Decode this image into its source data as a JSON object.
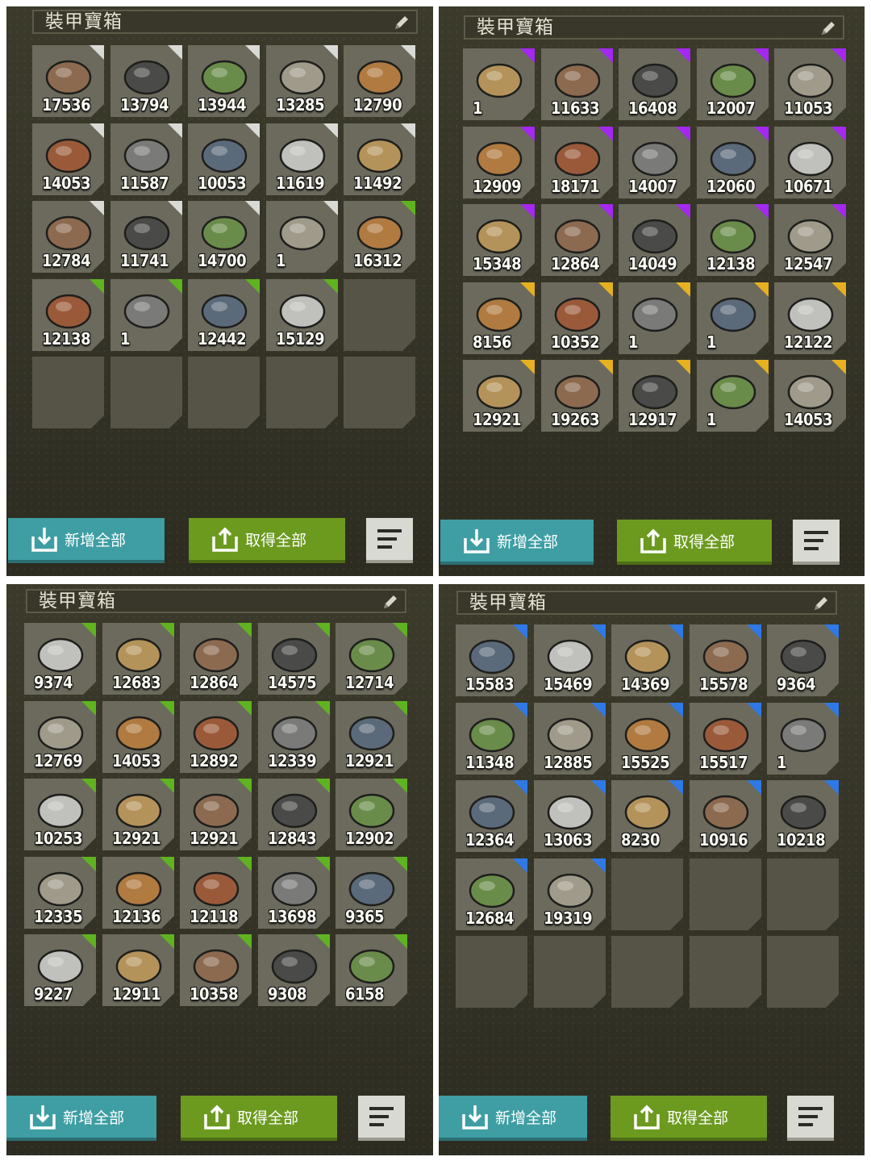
{
  "panels": [
    {
      "title": "裝甲寶箱",
      "add_all_label": "新增全部",
      "take_all_label": "取得全部",
      "items": [
        {
          "qty": "17536",
          "icon": "raw-meat-icon",
          "rarity": "white"
        },
        {
          "qty": "13794",
          "icon": "cloth-icon",
          "rarity": "white"
        },
        {
          "qty": "13944",
          "icon": "wire-coil-icon",
          "rarity": "white"
        },
        {
          "qty": "13285",
          "icon": "ore-icon",
          "rarity": "white"
        },
        {
          "qty": "12790",
          "icon": "plant-fiber-icon",
          "rarity": "white"
        },
        {
          "qty": "14053",
          "icon": "logs-icon",
          "rarity": "white"
        },
        {
          "qty": "11587",
          "icon": "planks-icon",
          "rarity": "white"
        },
        {
          "qty": "10053",
          "icon": "sand-pile-icon",
          "rarity": "white"
        },
        {
          "qty": "11619",
          "icon": "gas-canister-icon",
          "rarity": "white"
        },
        {
          "qty": "11492",
          "icon": "rope-icon",
          "rarity": "white"
        },
        {
          "qty": "12784",
          "icon": "leather-hide-icon",
          "rarity": "white"
        },
        {
          "qty": "11741",
          "icon": "stone-icon",
          "rarity": "white"
        },
        {
          "qty": "14700",
          "icon": "log-icon",
          "rarity": "white"
        },
        {
          "qty": "1",
          "icon": "tire-icon",
          "rarity": "white"
        },
        {
          "qty": "16312",
          "icon": "amber-resin-icon",
          "rarity": "green"
        },
        {
          "qty": "12138",
          "icon": "copper-ore-icon",
          "rarity": "green"
        },
        {
          "qty": "1",
          "icon": "wheel-icon",
          "rarity": "green"
        },
        {
          "qty": "12442",
          "icon": "meteorite-icon",
          "rarity": "green"
        },
        {
          "qty": "15129",
          "icon": "coal-rock-icon",
          "rarity": "green"
        }
      ]
    },
    {
      "title": "裝甲寶箱",
      "add_all_label": "新增全部",
      "take_all_label": "取得全部",
      "items": [
        {
          "qty": "1",
          "icon": "battery-icon",
          "rarity": "purple"
        },
        {
          "qty": "11633",
          "icon": "metal-block-icon",
          "rarity": "purple"
        },
        {
          "qty": "16408",
          "icon": "steel-plate-icon",
          "rarity": "purple"
        },
        {
          "qty": "12007",
          "icon": "spring-icon",
          "rarity": "purple"
        },
        {
          "qty": "11053",
          "icon": "wire-spool-icon",
          "rarity": "purple"
        },
        {
          "qty": "12909",
          "icon": "bearing-icon",
          "rarity": "purple"
        },
        {
          "qty": "18171",
          "icon": "copper-sheet-icon",
          "rarity": "purple"
        },
        {
          "qty": "14007",
          "icon": "copper-plate-icon",
          "rarity": "purple"
        },
        {
          "qty": "12060",
          "icon": "copper-coil-icon",
          "rarity": "purple"
        },
        {
          "qty": "10671",
          "icon": "wires-icon",
          "rarity": "purple"
        },
        {
          "qty": "15348",
          "icon": "scrap-metal-icon",
          "rarity": "purple"
        },
        {
          "qty": "12864",
          "icon": "saw-blade-icon",
          "rarity": "purple"
        },
        {
          "qty": "14049",
          "icon": "coil-spring-icon",
          "rarity": "purple"
        },
        {
          "qty": "12138",
          "icon": "rubber-sheet-icon",
          "rarity": "purple"
        },
        {
          "qty": "12547",
          "icon": "metal-sheet-icon",
          "rarity": "purple"
        },
        {
          "qty": "8156",
          "icon": "shock-absorber-icon",
          "rarity": "yellow"
        },
        {
          "qty": "10352",
          "icon": "tie-rod-icon",
          "rarity": "yellow"
        },
        {
          "qty": "1",
          "icon": "glass-panel-icon",
          "rarity": "yellow"
        },
        {
          "qty": "1",
          "icon": "electric-motor-icon",
          "rarity": "yellow"
        },
        {
          "qty": "12122",
          "icon": "spark-plug-icon",
          "rarity": "yellow"
        },
        {
          "qty": "12921",
          "icon": "rim-icon",
          "rarity": "yellow"
        },
        {
          "qty": "19263",
          "icon": "steel-ingot-icon",
          "rarity": "yellow"
        },
        {
          "qty": "12917",
          "icon": "crystal-ore-icon",
          "rarity": "yellow"
        },
        {
          "qty": "1",
          "icon": "spring-coil-icon",
          "rarity": "yellow"
        },
        {
          "qty": "14053",
          "icon": "gold-wire-spool-icon",
          "rarity": "yellow"
        }
      ]
    },
    {
      "title": "裝甲寶箱",
      "add_all_label": "新增全部",
      "take_all_label": "取得全部",
      "items": [
        {
          "qty": "9374",
          "icon": "coal-icon",
          "rarity": "green"
        },
        {
          "qty": "12683",
          "icon": "bolt-nut-icon",
          "rarity": "green"
        },
        {
          "qty": "12864",
          "icon": "rubber-block-icon",
          "rarity": "green"
        },
        {
          "qty": "14575",
          "icon": "foil-icon",
          "rarity": "green"
        },
        {
          "qty": "12714",
          "icon": "duct-tape-icon",
          "rarity": "green"
        },
        {
          "qty": "12769",
          "icon": "nails-icon",
          "rarity": "green"
        },
        {
          "qty": "14053",
          "icon": "chemical-jar-icon",
          "rarity": "green"
        },
        {
          "qty": "12892",
          "icon": "sulfur-crystals-icon",
          "rarity": "green"
        },
        {
          "qty": "12339",
          "icon": "gear-parts-icon",
          "rarity": "green"
        },
        {
          "qty": "12921",
          "icon": "wristwatch-icon",
          "rarity": "green"
        },
        {
          "qty": "10253",
          "icon": "tire-icon",
          "rarity": "green"
        },
        {
          "qty": "12921",
          "icon": "folder-icon",
          "rarity": "green"
        },
        {
          "qty": "12921",
          "icon": "sandbag-icon",
          "rarity": "green"
        },
        {
          "qty": "12843",
          "icon": "canister-icon",
          "rarity": "green"
        },
        {
          "qty": "12902",
          "icon": "glass-lens-icon",
          "rarity": "green"
        },
        {
          "qty": "12335",
          "icon": "glue-bottle-icon",
          "rarity": "green"
        },
        {
          "qty": "12136",
          "icon": "jar-icon",
          "rarity": "green"
        },
        {
          "qty": "12118",
          "icon": "fuel-jug-icon",
          "rarity": "green"
        },
        {
          "qty": "13698",
          "icon": "poison-jar-icon",
          "rarity": "green"
        },
        {
          "qty": "9365",
          "icon": "copper-scrap-icon",
          "rarity": "green"
        },
        {
          "qty": "9227",
          "icon": "gear-shaft-icon",
          "rarity": "green"
        },
        {
          "qty": "12911",
          "icon": "paper-stack-icon",
          "rarity": "green"
        },
        {
          "qty": "10358",
          "icon": "flask-icon",
          "rarity": "green"
        },
        {
          "qty": "9308",
          "icon": "fur-pelt-icon",
          "rarity": "green"
        },
        {
          "qty": "6158",
          "icon": "paper-bundle-icon",
          "rarity": "green"
        }
      ]
    },
    {
      "title": "裝甲寶箱",
      "add_all_label": "新增全部",
      "take_all_label": "取得全部",
      "items": [
        {
          "qty": "15583",
          "icon": "pressure-gauge-icon",
          "rarity": "blue"
        },
        {
          "qty": "15469",
          "icon": "blue-cloth-icon",
          "rarity": "blue"
        },
        {
          "qty": "14369",
          "icon": "aluminum-ingot-icon",
          "rarity": "blue"
        },
        {
          "qty": "15578",
          "icon": "pliers-icon",
          "rarity": "blue"
        },
        {
          "qty": "9364",
          "icon": "exhaust-pipe-icon",
          "rarity": "blue"
        },
        {
          "qty": "11348",
          "icon": "hide-icon",
          "rarity": "blue"
        },
        {
          "qty": "12885",
          "icon": "thread-spool-icon",
          "rarity": "blue"
        },
        {
          "qty": "15525",
          "icon": "steel-sheet-icon",
          "rarity": "blue"
        },
        {
          "qty": "15517",
          "icon": "cable-coil-icon",
          "rarity": "blue"
        },
        {
          "qty": "1",
          "icon": "gears-icon",
          "rarity": "blue"
        },
        {
          "qty": "12364",
          "icon": "oil-can-icon",
          "rarity": "blue"
        },
        {
          "qty": "13063",
          "icon": "brick-icon",
          "rarity": "blue"
        },
        {
          "qty": "8230",
          "icon": "pocket-watch-icon",
          "rarity": "blue"
        },
        {
          "qty": "10916",
          "icon": "engine-motor-icon",
          "rarity": "blue"
        },
        {
          "qty": "10218",
          "icon": "circuit-board-icon",
          "rarity": "blue"
        },
        {
          "qty": "12684",
          "icon": "metal-pipe-icon",
          "rarity": "blue"
        },
        {
          "qty": "19319",
          "icon": "paint-can-icon",
          "rarity": "blue"
        }
      ]
    }
  ],
  "colors": {
    "white": "#d9d9d6",
    "green": "#5fb320",
    "purple": "#a528f0",
    "yellow": "#e6b020",
    "blue": "#2f79e6",
    "add_button": "#3e9ea3",
    "take_button": "#6c9a1f"
  }
}
